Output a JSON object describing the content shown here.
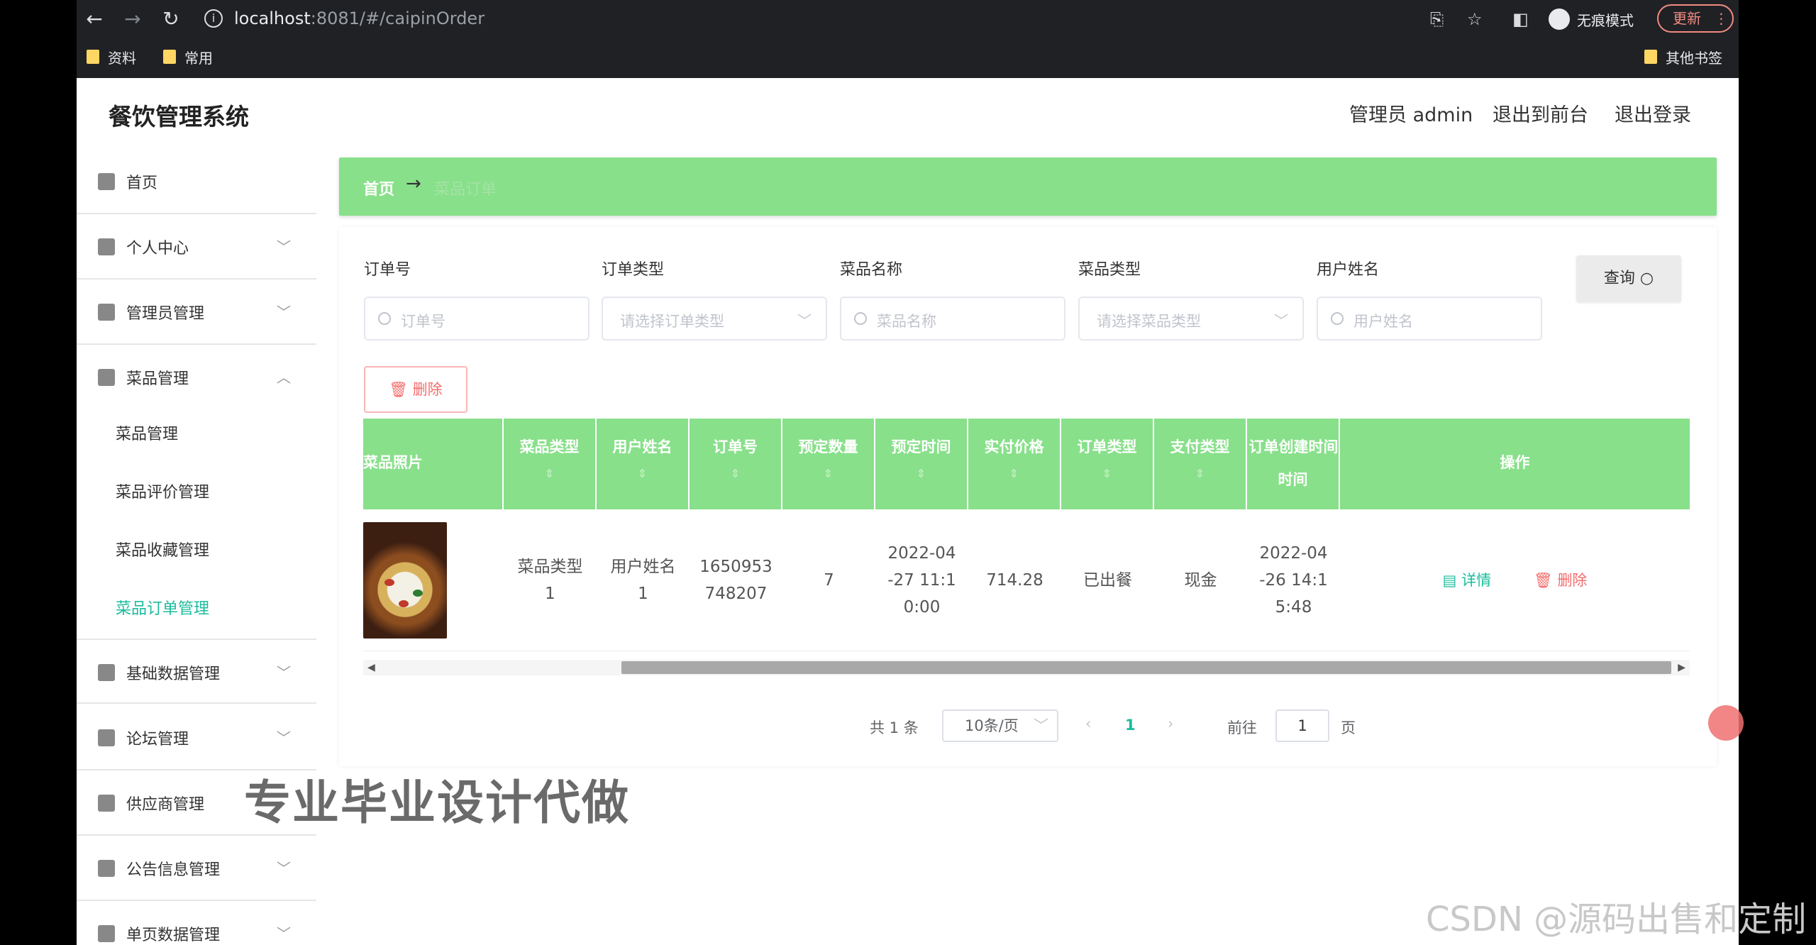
{
  "browser": {
    "url_host": "localhost",
    "url_rest": ":8081/#/caipinOrder",
    "incognito_label": "无痕模式",
    "update_label": "更新",
    "bookmarks": [
      "资料",
      "常用"
    ],
    "other_bookmarks": "其他书签"
  },
  "app": {
    "title": "餐饮管理系统",
    "admin_label": "管理员 admin",
    "exit_front": "退出到前台",
    "logout": "退出登录"
  },
  "sidebar": {
    "items": [
      {
        "label": "首页",
        "icon": "home-icon"
      },
      {
        "label": "个人中心",
        "icon": "user-icon"
      },
      {
        "label": "管理员管理",
        "icon": "clipboard-icon"
      },
      {
        "label": "菜品管理",
        "icon": "sliders-icon"
      },
      {
        "label": "基础数据管理",
        "icon": "checklist-icon"
      },
      {
        "label": "论坛管理",
        "icon": "briefcase-icon"
      },
      {
        "label": "供应商管理",
        "icon": "user-icon"
      },
      {
        "label": "公告信息管理",
        "icon": "chart-icon"
      },
      {
        "label": "单页数据管理",
        "icon": "page-icon"
      }
    ],
    "sub_items": [
      "菜品管理",
      "菜品评价管理",
      "菜品收藏管理",
      "菜品订单管理"
    ]
  },
  "breadcrumb": {
    "home": "首页",
    "arrow": "→",
    "current": "菜品订单"
  },
  "filters": {
    "order_no_label": "订单号",
    "order_no_placeholder": "订单号",
    "order_type_label": "订单类型",
    "order_type_placeholder": "请选择订单类型",
    "dish_name_label": "菜品名称",
    "dish_name_placeholder": "菜品名称",
    "dish_type_label": "菜品类型",
    "dish_type_placeholder": "请选择菜品类型",
    "user_name_label": "用户姓名",
    "user_name_placeholder": "用户姓名",
    "query_label": "查询",
    "delete_label": "删除"
  },
  "table": {
    "headers": [
      "菜品照片",
      "菜品类型",
      "用户姓名",
      "订单号",
      "预定数量",
      "预定时间",
      "实付价格",
      "订单类型",
      "支付类型",
      "订单创建时间",
      "操作"
    ],
    "header_line2": "时间",
    "row": {
      "dish_type_l1": "菜品类型",
      "dish_type_l2": "1",
      "user_name_l1": "用户姓名",
      "user_name_l2": "1",
      "order_no_l1": "1650953",
      "order_no_l2": "748207",
      "quantity": "7",
      "reserve_time_l1": "2022-04",
      "reserve_time_l2": "-27 11:1",
      "reserve_time_l3": "0:00",
      "price": "714.28",
      "order_type": "已出餐",
      "pay_type": "现金",
      "created_l1": "2022-04",
      "created_l2": "-26 14:1",
      "created_l3": "5:48",
      "detail": "详情",
      "delete": "删除"
    }
  },
  "pagination": {
    "total": "共 1 条",
    "page_size": "10条/页",
    "current_page": "1",
    "goto_label": "前往",
    "goto_value": "1",
    "page_suffix": "页"
  },
  "overlay": {
    "banner": "专业毕业设计代做",
    "csdn": "CSDN @源码出售和定制"
  },
  "colors": {
    "accent_green": "#88e08a",
    "active_teal": "#1abc9c",
    "danger_red": "#f56c6c"
  }
}
